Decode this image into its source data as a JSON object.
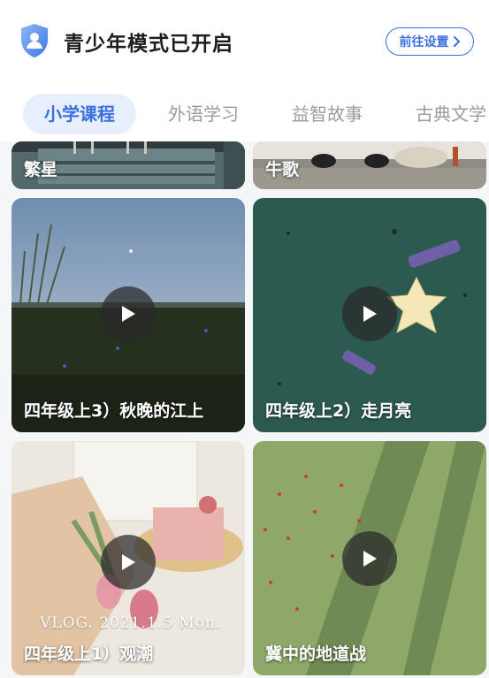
{
  "header": {
    "title": "青少年模式已开启",
    "settings_button": "前往设置"
  },
  "tabs": [
    {
      "label": "小学课程",
      "active": true
    },
    {
      "label": "外语学习",
      "active": false
    },
    {
      "label": "益智故事",
      "active": false
    },
    {
      "label": "古典文学",
      "active": false
    }
  ],
  "cards": [
    {
      "title": "繁星"
    },
    {
      "title": "牛歌"
    },
    {
      "title": "四年级上3）秋晚的江上"
    },
    {
      "title": "四年级上2）走月亮"
    },
    {
      "title": "四年级上1）观潮",
      "overlay_text": "VLOG. 2021.1.5 Mon."
    },
    {
      "title": "冀中的地道战"
    }
  ],
  "colors": {
    "accent": "#3a6fe0",
    "active_tab_bg": "#e8effc",
    "inactive_tab": "#9a9ca3"
  }
}
